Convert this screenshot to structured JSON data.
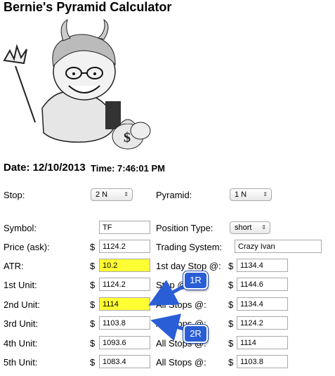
{
  "title": "Bernie's Pyramid Calculator",
  "header": {
    "date_label": "Date: 12/10/2013",
    "time_label": "Time: 7:46:01 PM"
  },
  "currency": "$",
  "left": {
    "stop_label": "Stop:",
    "stop_value": "2 N",
    "symbol_label": "Symbol:",
    "symbol_value": "TF",
    "price_label": "Price (ask):",
    "price_value": "1124.2",
    "atr_label": "ATR:",
    "atr_value": "10.2",
    "units": [
      {
        "label": "1st Unit:",
        "value": "1124.2"
      },
      {
        "label": "2nd Unit:",
        "value": "1114"
      },
      {
        "label": "3rd Unit:",
        "value": "1103.8"
      },
      {
        "label": "4th Unit:",
        "value": "1093.6"
      },
      {
        "label": "5th Unit:",
        "value": "1083.4"
      }
    ]
  },
  "right": {
    "pyramid_label": "Pyramid:",
    "pyramid_value": "1 N",
    "position_type_label": "Position Type:",
    "position_type_value": "short",
    "trading_system_label": "Trading System:",
    "trading_system_value": "Crazy Ivan",
    "stops": [
      {
        "label": "1st day Stop @:",
        "value": "1134.4"
      },
      {
        "label": "Stop @",
        "value": "1144.6"
      },
      {
        "label": "All Stops @:",
        "value": "1134.4"
      },
      {
        "label": "All Stops @:",
        "value": "1124.2"
      },
      {
        "label": "All Stops @:",
        "value": "1114"
      },
      {
        "label": "All Stops @:",
        "value": "1103.8"
      }
    ]
  },
  "callouts": {
    "first": "1R",
    "second": "2R"
  },
  "colors": {
    "highlight": "#ffff33",
    "callout": "#2a5ed6"
  },
  "icons": {
    "dropdown": "chevron-updown-icon",
    "illustration": "devil-caricature-illustration"
  }
}
